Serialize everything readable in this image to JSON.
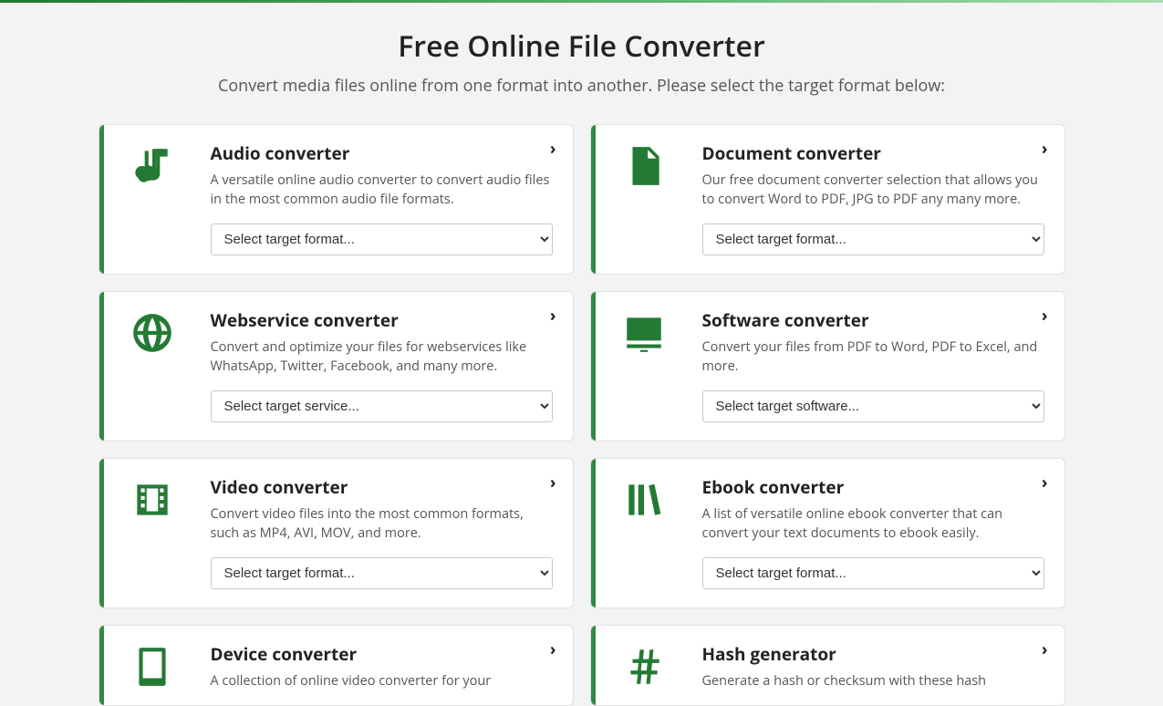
{
  "title": "Free Online File Converter",
  "subtitle": "Convert media files online from one format into another. Please select the target format below:",
  "cards": [
    {
      "title": "Audio converter",
      "desc": "A versatile online audio converter to convert audio files in the most common audio file formats.",
      "select": "Select target format..."
    },
    {
      "title": "Document converter",
      "desc": "Our free document converter selection that allows you to convert Word to PDF, JPG to PDF any many more.",
      "select": "Select target format..."
    },
    {
      "title": "Webservice converter",
      "desc": "Convert and optimize your files for webservices like WhatsApp, Twitter, Facebook, and many more.",
      "select": "Select target service..."
    },
    {
      "title": "Software converter",
      "desc": "Convert your files from PDF to Word, PDF to Excel, and more.",
      "select": "Select target software..."
    },
    {
      "title": "Video converter",
      "desc": "Convert video files into the most common formats, such as MP4, AVI, MOV, and more.",
      "select": "Select target format..."
    },
    {
      "title": "Ebook converter",
      "desc": "A list of versatile online ebook converter that can convert your text documents to ebook easily.",
      "select": "Select target format..."
    },
    {
      "title": "Device converter",
      "desc": "A collection of online video converter for your",
      "select": ""
    },
    {
      "title": "Hash generator",
      "desc": "Generate a hash or checksum with these hash",
      "select": ""
    }
  ]
}
